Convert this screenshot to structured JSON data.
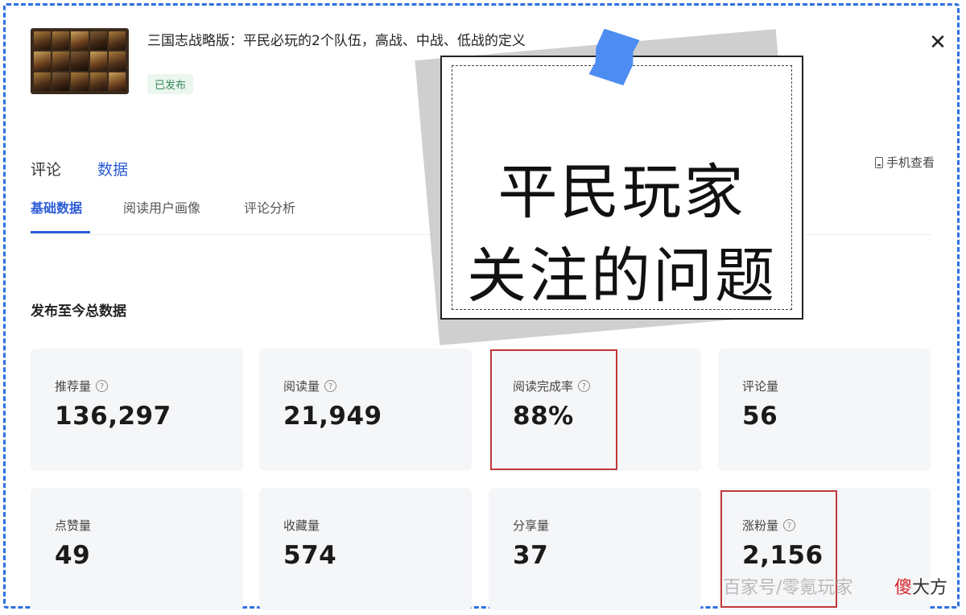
{
  "article": {
    "title": "三国志战略版：平民必玩的2个队伍，高战、中战、低战的定义",
    "status": "已发布"
  },
  "tabs": {
    "main": [
      "评论",
      "数据"
    ],
    "active_main": "数据",
    "sub": [
      "基础数据",
      "阅读用户画像",
      "评论分析"
    ],
    "active_sub": "基础数据",
    "mobile_view_label": "手机查看"
  },
  "section_title": "发布至今总数据",
  "stats": [
    {
      "label": "推荐量",
      "value": "136,297",
      "help": true
    },
    {
      "label": "阅读量",
      "value": "21,949",
      "help": true
    },
    {
      "label": "阅读完成率",
      "value": "88%",
      "help": true,
      "highlighted": true
    },
    {
      "label": "评论量",
      "value": "56",
      "help": false
    },
    {
      "label": "点赞量",
      "value": "49",
      "help": false
    },
    {
      "label": "收藏量",
      "value": "574",
      "help": false
    },
    {
      "label": "分享量",
      "value": "37",
      "help": false
    },
    {
      "label": "涨粉量",
      "value": "2,156",
      "help": true,
      "highlighted": true
    }
  ],
  "overlay": {
    "line1": "平民玩家",
    "line2": "关注的问题",
    "tape_color": "#4d8cf0"
  },
  "watermark": {
    "text": "百家号/零氪玩家",
    "logo_red": "傻",
    "logo_rest": "大方"
  },
  "colors": {
    "accent": "#2b5bd6",
    "highlight": "#c0393b",
    "frame": "#2f6fe0",
    "published": "#3a8a5a"
  },
  "icons": {
    "close": "close-icon",
    "help": "help-icon",
    "phone": "phone-icon"
  }
}
